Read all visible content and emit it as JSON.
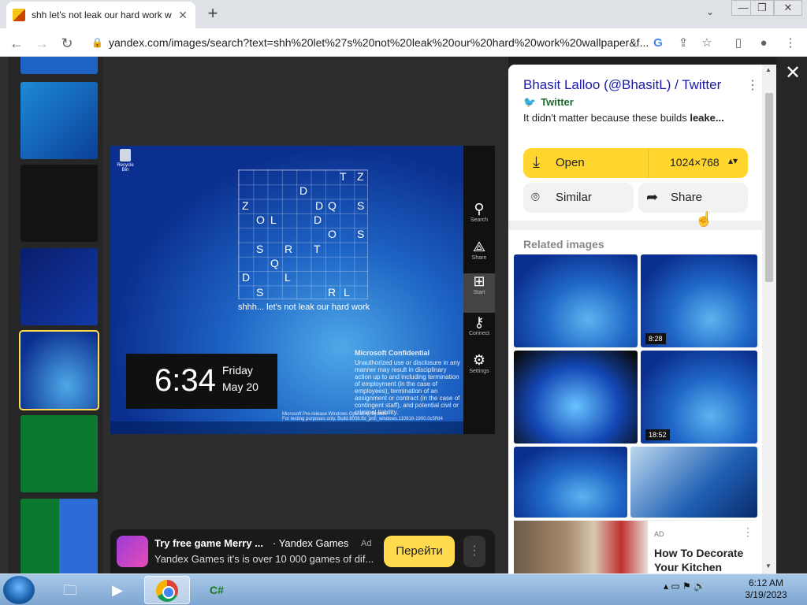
{
  "browser": {
    "tab_title": "shh let's not leak our hard work w",
    "tab_close": "✕",
    "new_tab": "+",
    "tab_search": "⌄",
    "window_controls": {
      "minimize": "—",
      "restore": "❐",
      "close": "✕"
    },
    "url": "yandex.com/images/search?text=shh%20let%27s%20not%20leak%20our%20hard%20work%20wallpaper&f...",
    "nav": {
      "back": "←",
      "forward": "→",
      "reload": "↻"
    },
    "toolbar_icons": [
      "google-icon",
      "share-icon",
      "star-icon",
      "sidebar-icon",
      "profile-icon",
      "menu-icon"
    ]
  },
  "viewer": {
    "image": {
      "recycle_bin": "Recycle Bin",
      "grid_letters": [
        "T",
        "Z",
        "D",
        "Z",
        "D",
        "Q",
        "S",
        "O",
        "L",
        "D",
        "O",
        "S",
        "S",
        "R",
        "T",
        "Q",
        "D",
        "L",
        "S",
        "R",
        "L"
      ],
      "caption": "shhh... let's not leak our hard work",
      "clock_time": "6:34",
      "clock_day": "Friday",
      "clock_date": "May 20",
      "confidential_title": "Microsoft Confidential",
      "confidential_text": "Unauthorized use or disclosure in any manner may result in disciplinary action up to and including termination of employment (in the case of employees), termination of an assignment or contract (in the case of contingent staff), and potential civil or criminal liability.",
      "build_text": "For testing purposes only. Build 8008.fbl_pml_windows.110818-1900.0c5ffd4",
      "prerelease": "Microsoft Pre-release Windows Operating System",
      "charms": [
        {
          "label": "Search",
          "icon": "search-icon"
        },
        {
          "label": "Share",
          "icon": "share-icon"
        },
        {
          "label": "Start",
          "icon": "windows-icon"
        },
        {
          "label": "Connect",
          "icon": "connect-icon"
        },
        {
          "label": "Settings",
          "icon": "gear-icon"
        }
      ]
    },
    "ad": {
      "title": "Try free game Merry ...",
      "source": "· Yandex Games",
      "tag": "Ad",
      "description": "Yandex Games it's is over 10 000 games of dif...",
      "cta": "Перейти",
      "more": "⋮"
    }
  },
  "panel": {
    "close": "✕",
    "title": "Bhasit Lalloo (@BhasitL) / Twitter",
    "kebab": "⋮",
    "source": "Twitter",
    "description_plain": "It didn't matter because these builds ",
    "description_bold": "leake...",
    "open_label": "Open",
    "size_label": "1024×768",
    "similar_label": "Similar",
    "share_label": "Share",
    "related_label": "Related images",
    "related_times": [
      "8:28",
      "18:52"
    ],
    "ad_tag": "AD",
    "ad_title": "How To Decorate Your Kitchen",
    "ad_kebab": "⋮"
  },
  "taskbar": {
    "items": [
      "explorer-icon",
      "media-player-icon",
      "chrome-icon",
      "csharp-icon"
    ],
    "csharp": "C#",
    "time": "6:12 AM",
    "date": "3/19/2023"
  },
  "colors": {
    "accent": "#ffdb4d",
    "link": "#1a1aa6",
    "twitter": "#1d9bf0"
  }
}
